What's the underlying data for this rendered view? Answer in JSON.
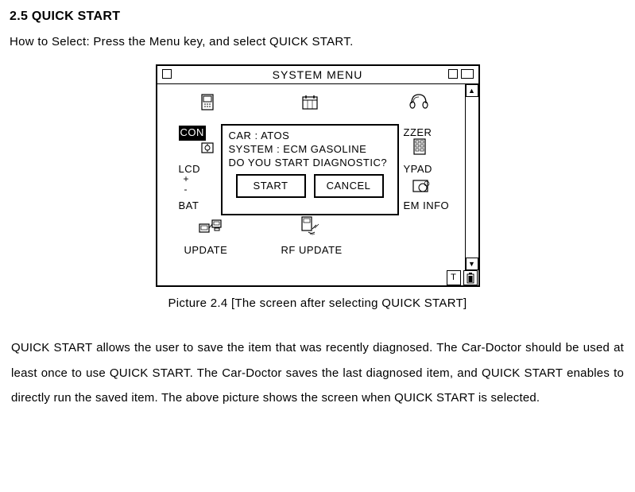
{
  "heading": "2.5 QUICK START",
  "howto": "How to Select: Press the Menu key, and select QUICK START.",
  "screenshot": {
    "title": "SYSTEM MENU",
    "dialog": {
      "line1": "CAR : ATOS",
      "line2": "SYSTEM : ECM GASOLINE",
      "line3": "DO YOU START DIAGNOSTIC?",
      "start": "START",
      "cancel": "CANCEL"
    },
    "labels": {
      "con": "CON",
      "zzer": "ZZER",
      "lcd": "LCD",
      "ypad": "YPAD",
      "bat": "BAT",
      "eminfo": "EM INFO",
      "update": "UPDATE",
      "rfupdate": "RF UPDATE"
    },
    "status": {
      "t": "T",
      "b": "▮"
    }
  },
  "caption": "Picture 2.4 [The screen after selecting QUICK START]",
  "paragraph": "QUICK START allows the user to save the item that was recently diagnosed. The Car-Doctor should be used at least once to use QUICK START. The Car-Doctor saves the last diagnosed item, and QUICK START enables to directly run the saved item. The above picture shows the screen when QUICK START is selected."
}
